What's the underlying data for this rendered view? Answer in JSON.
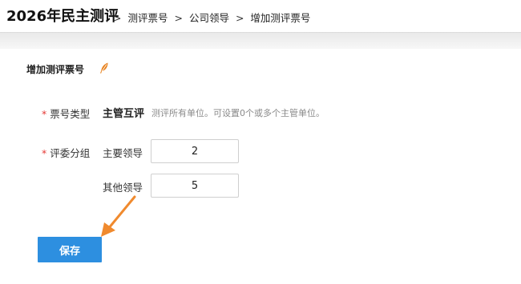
{
  "header": {
    "title": "2026年民主测评",
    "breadcrumb": [
      {
        "label": "测评票号"
      },
      {
        "label": "公司领导"
      },
      {
        "label": "增加测评票号"
      }
    ],
    "separator": ">"
  },
  "section": {
    "title": "增加测评票号",
    "icon": "feather-icon",
    "icon_color": "#e8821e"
  },
  "form": {
    "required_mark": "*",
    "ticket_type": {
      "label": "票号类型",
      "value": "主管互评",
      "hint": "测评所有单位。可设置0个或多个主管单位。"
    },
    "committee_group": {
      "label": "评委分组",
      "rows": [
        {
          "label": "主要领导",
          "value": "2"
        },
        {
          "label": "其他领导",
          "value": "5"
        }
      ]
    }
  },
  "actions": {
    "save_label": "保存",
    "save_color": "#2d8fe0"
  },
  "annotation": {
    "arrow_color": "#f08a2e",
    "icon": "arrow-pointer-icon"
  }
}
